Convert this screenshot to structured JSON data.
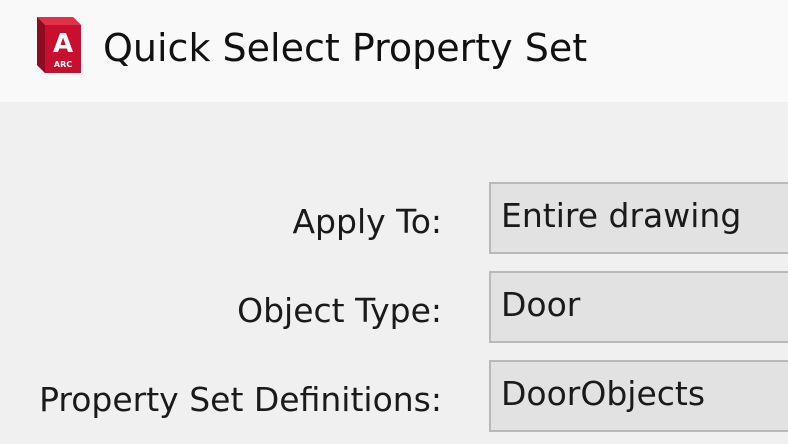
{
  "window": {
    "title": "Quick Select Property Set",
    "icon": {
      "name": "autocad-architecture-app-icon",
      "letter": "A",
      "sub": "ARC",
      "color": "#c8102e"
    }
  },
  "form": {
    "apply_to": {
      "label": "Apply To:",
      "value": "Entire drawing"
    },
    "object_type": {
      "label": "Object Type:",
      "value": "Door"
    },
    "property_set_definitions": {
      "label": "Property Set Definitions:",
      "value": "DoorObjects"
    }
  }
}
